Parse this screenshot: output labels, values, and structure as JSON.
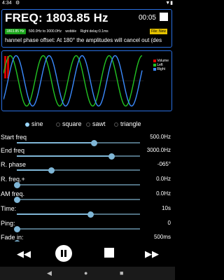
{
  "status": {
    "time": "4:34",
    "gear_icon": "gear-icon",
    "battery_icon": "battery-icon"
  },
  "panel": {
    "freq_label": "FREQ: 1803.85 Hz",
    "elapsed": "00:05",
    "badge_freq": "1803.85 Hz",
    "range": "500.0Hz to 3000.0Hz",
    "mode": "wobble",
    "delay": "Right delay:0.1ms",
    "file_badge": "File: New",
    "message": "hannel phase offset: At 180° the amplitudes will cancel out (des"
  },
  "legend": [
    {
      "name": "Volume",
      "color": "#e00000"
    },
    {
      "name": "Left",
      "color": "#22c422"
    },
    {
      "name": "Right",
      "color": "#3b8bff"
    }
  ],
  "waveforms": {
    "options": [
      "sine",
      "square",
      "sawt",
      "triangle"
    ],
    "selected": "sine"
  },
  "params": [
    {
      "label": "Start freq",
      "value": "500.0Hz",
      "level": 0.63
    },
    {
      "label": "End freq",
      "value": "3000.0Hz",
      "level": 0.77
    },
    {
      "label": "R. phase",
      "value": "-065°",
      "level": 0.28
    },
    {
      "label": "R. freq.+",
      "value": "0.0Hz",
      "level": 0.0
    },
    {
      "label": "AM freq.",
      "value": "0.0Hz",
      "level": 0.0
    },
    {
      "label": "Time:",
      "value": "10s",
      "level": 0.6
    },
    {
      "label": "Ping:",
      "value": "0",
      "level": 0.0
    },
    {
      "label": "Fade in:",
      "value": "500ms",
      "level": 0.0
    }
  ],
  "transport": {
    "rewind_icon": "rewind-icon",
    "pause_icon": "pause-icon",
    "stop_icon": "stop-icon",
    "forward_icon": "fast-forward-icon"
  },
  "nav": {
    "back_icon": "back-triangle-icon",
    "home_icon": "home-circle-icon",
    "recents_icon": "recents-square-icon"
  }
}
